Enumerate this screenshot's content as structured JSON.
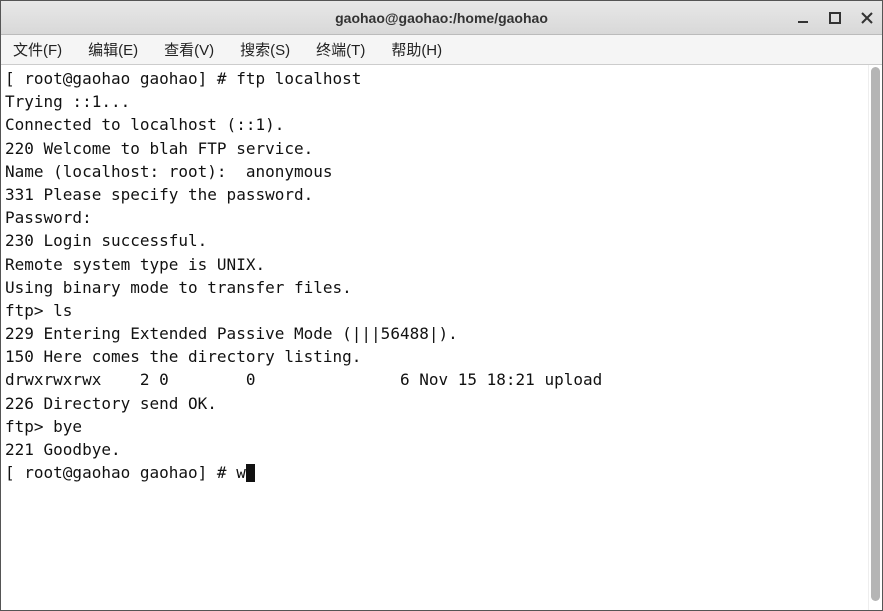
{
  "window": {
    "title": "gaohao@gaohao:/home/gaohao"
  },
  "menu": {
    "file": "文件(F)",
    "edit": "编辑(E)",
    "view": "查看(V)",
    "search": "搜索(S)",
    "terminal": "终端(T)",
    "help": "帮助(H)"
  },
  "terminal": {
    "lines": [
      "[ root@gaohao gaohao] # ftp localhost",
      "Trying ::1...",
      "Connected to localhost (::1).",
      "220 Welcome to blah FTP service.",
      "Name (localhost: root):  anonymous",
      "331 Please specify the password.",
      "Password:",
      "230 Login successful.",
      "Remote system type is UNIX.",
      "Using binary mode to transfer files.",
      "ftp> ls",
      "229 Entering Extended Passive Mode (|||56488|).",
      "150 Here comes the directory listing.",
      "drwxrwxrwx    2 0        0               6 Nov 15 18:21 upload",
      "226 Directory send OK.",
      "ftp> bye",
      "221 Goodbye.",
      "[ root@gaohao gaohao] # w"
    ]
  }
}
